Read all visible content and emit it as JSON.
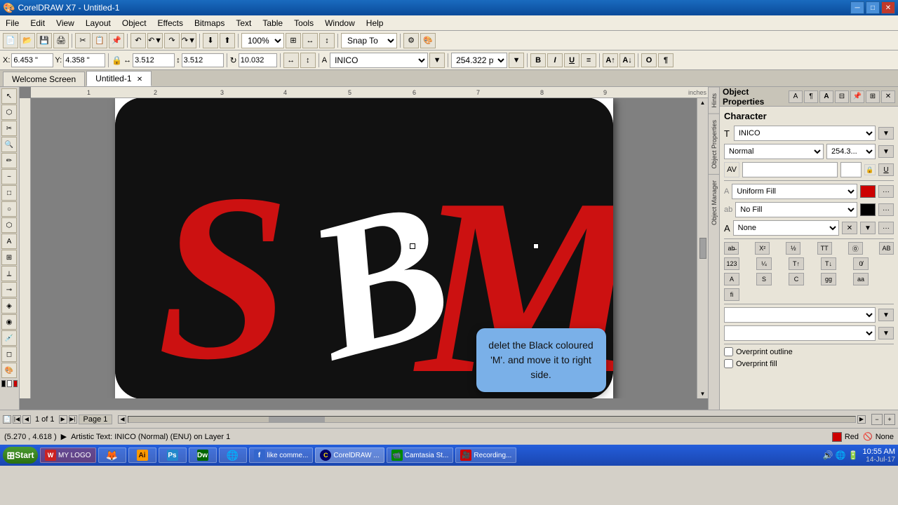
{
  "titlebar": {
    "title": "CorelDRAW X7 - Untitled-1",
    "app_icon": "★",
    "controls": [
      "—",
      "□",
      "✕"
    ]
  },
  "menubar": {
    "items": [
      "File",
      "Edit",
      "View",
      "Layout",
      "Object",
      "Effects",
      "Bitmaps",
      "Text",
      "Table",
      "Tools",
      "Window",
      "Help"
    ]
  },
  "toolbar1": {
    "zoom_label": "100%",
    "snap_label": "Snap To"
  },
  "toolbar2": {
    "x_label": "X:",
    "x_value": "6.453 \"",
    "y_label": "Y:",
    "y_value": "4.358 \"",
    "lock_icon": "🔒",
    "w_value": "3.512",
    "h_value": "3.512",
    "rotate_value": "10.032",
    "font_name": "INICO",
    "font_size": "254.322 pt",
    "bold": "B",
    "italic": "I",
    "underline": "U"
  },
  "tabs": {
    "items": [
      {
        "label": "Welcome Screen",
        "active": false
      },
      {
        "label": "Untitled-1",
        "active": true
      }
    ]
  },
  "canvas": {
    "page_label": "Page 1"
  },
  "panel": {
    "title": "Object Properties",
    "section": "Character",
    "font_name": "INICO",
    "style": "Normal",
    "size": "254.3...",
    "fill_type": "Uniform Fill",
    "fill_color": "#cc0000",
    "outline_type": "No Fill",
    "outline_color": "#000000",
    "effect_type": "None",
    "overprint_outline": "Overprint outline",
    "overprint_fill": "Overprint fill"
  },
  "tooltip": {
    "text": "delet the Black coloured 'M'. and move it to right side."
  },
  "statusbar": {
    "coords": "(5.270 , 4.618 )",
    "play_icon": "▶",
    "desc": "Artistic Text: INICO (Normal) (ENU) on Layer 1",
    "color": "Red",
    "outline": "None"
  },
  "page_nav": {
    "page_text": "1 of 1",
    "page_label": "Page 1"
  },
  "taskbar": {
    "start_label": "Start",
    "time": "10:55 AM",
    "date": "14-Jul-17",
    "apps": [
      {
        "label": "MY LOGO",
        "icon": "W",
        "color": "#e22"
      },
      {
        "label": "🦊",
        "icon": "🦊",
        "color": "#f80"
      },
      {
        "label": "Ai",
        "icon": "Ai",
        "color": "#f90"
      },
      {
        "label": "Ps",
        "icon": "Ps",
        "color": "#28c"
      },
      {
        "label": "Dw",
        "icon": "Dw",
        "color": "#060"
      },
      {
        "label": "🌐",
        "icon": "🌐",
        "color": "#38f"
      },
      {
        "label": "like comme...",
        "icon": "f",
        "color": "#36c"
      },
      {
        "label": "CorelDRAW ...",
        "icon": "C",
        "color": "#060",
        "active": true
      },
      {
        "label": "Camtasia St...",
        "icon": "📹",
        "color": "#080"
      },
      {
        "label": "Recording...",
        "icon": "🎥",
        "color": "#c00"
      }
    ]
  },
  "rulers": {
    "top_marks": [
      "1",
      "2",
      "3",
      "4",
      "5",
      "6",
      "7",
      "8",
      "9"
    ],
    "unit": "inches"
  }
}
